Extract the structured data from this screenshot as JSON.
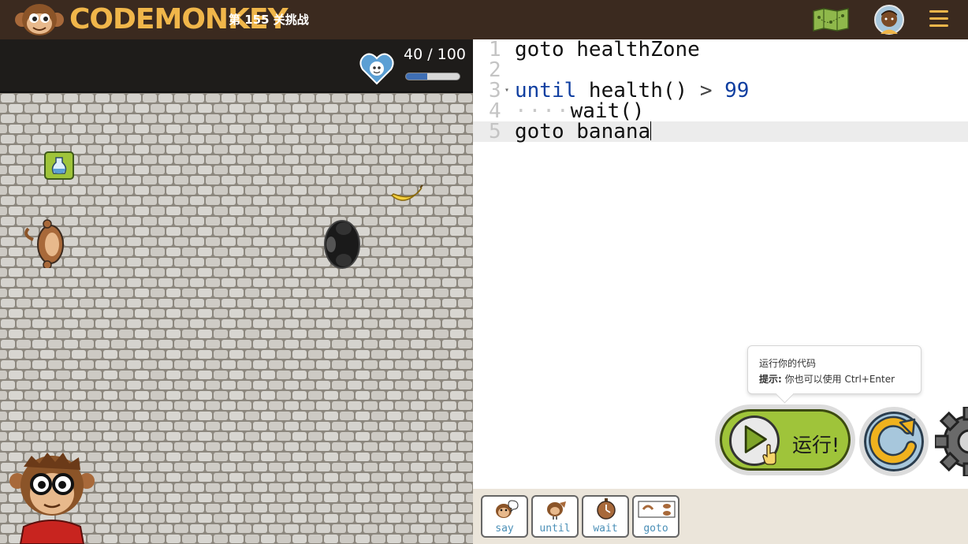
{
  "header": {
    "logo_text": "CODEMONKEY",
    "level_title": "第 155 关挑战"
  },
  "hud": {
    "health_text": "40 / 100",
    "health_value": 40,
    "health_max": 100
  },
  "editor": {
    "lines": [
      {
        "num": "1",
        "code": "goto healthZone"
      },
      {
        "num": "2",
        "code": ""
      },
      {
        "num": "3",
        "kw": "until",
        "call": " health() ",
        "op": ">",
        "num_value": " 99"
      },
      {
        "num": "4",
        "indent": "····",
        "code": "wait()"
      },
      {
        "num": "5",
        "code": "goto banana"
      }
    ]
  },
  "tooltip": {
    "title": "运行你的代码",
    "hint_label": "提示:",
    "hint_text": " 你也可以使用 Ctrl+Enter"
  },
  "controls": {
    "run_label": "运行!"
  },
  "toolbox": {
    "items": [
      {
        "label": "say",
        "icon": "monkey-speech-icon"
      },
      {
        "label": "until",
        "icon": "bulb-icon"
      },
      {
        "label": "wait",
        "icon": "stopwatch-icon"
      },
      {
        "label": "goto",
        "icon": "footprints-icon"
      }
    ]
  },
  "colors": {
    "header_bg": "#3b2a1f",
    "logo": "#f0b64a",
    "run_button": "#9fc43a",
    "reset_button": "#a7c7dc",
    "keyword": "#0f3ea0"
  }
}
